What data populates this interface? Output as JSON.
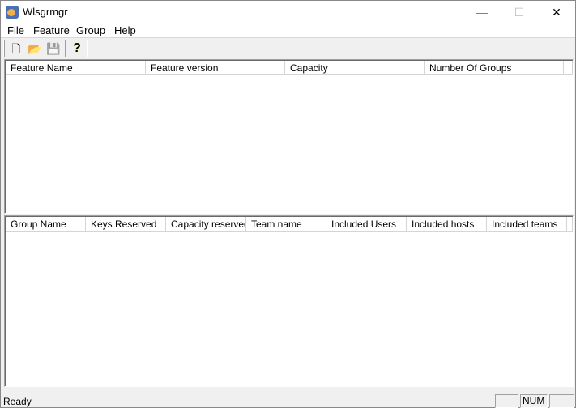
{
  "window": {
    "title": "Wlsgrmgr",
    "minimize": "—",
    "maximize": "☐",
    "close": "✕"
  },
  "menu": [
    "File",
    "Feature",
    "Group",
    "Help"
  ],
  "toolbar": {
    "new_icon": "🗋",
    "open_icon": "📂",
    "save_icon": "💾",
    "help_icon": "?"
  },
  "features_table": {
    "columns": [
      "Feature Name",
      "Feature version",
      "Capacity",
      "Number Of Groups"
    ],
    "rows": []
  },
  "groups_table": {
    "columns": [
      "Group Name",
      "Keys Reserved",
      "Capacity reserved",
      "Team name",
      "Included Users",
      "Included hosts",
      "Included teams"
    ],
    "rows": []
  },
  "status": {
    "text": "Ready",
    "num": "NUM"
  }
}
